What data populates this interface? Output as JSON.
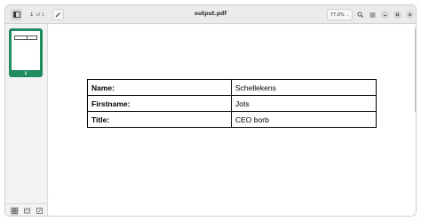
{
  "window": {
    "title": "output.pdf"
  },
  "toolbar": {
    "page_current": "1",
    "page_of": "of 1",
    "zoom": "77,0%"
  },
  "sidebar": {
    "thumbnail_label": "1",
    "footer_buttons": [
      "thumbnails-icon",
      "outline-icon",
      "annotations-icon"
    ]
  },
  "document": {
    "rows": [
      {
        "label": "Name:",
        "value": "Schellekens"
      },
      {
        "label": "Firstname:",
        "value": "Jots"
      },
      {
        "label": "Title:",
        "value": "CEO borb"
      }
    ]
  },
  "colors": {
    "accent": "#1f8b5e",
    "headerbar": "#ebebeb",
    "sidebar": "#f3f3f3"
  }
}
